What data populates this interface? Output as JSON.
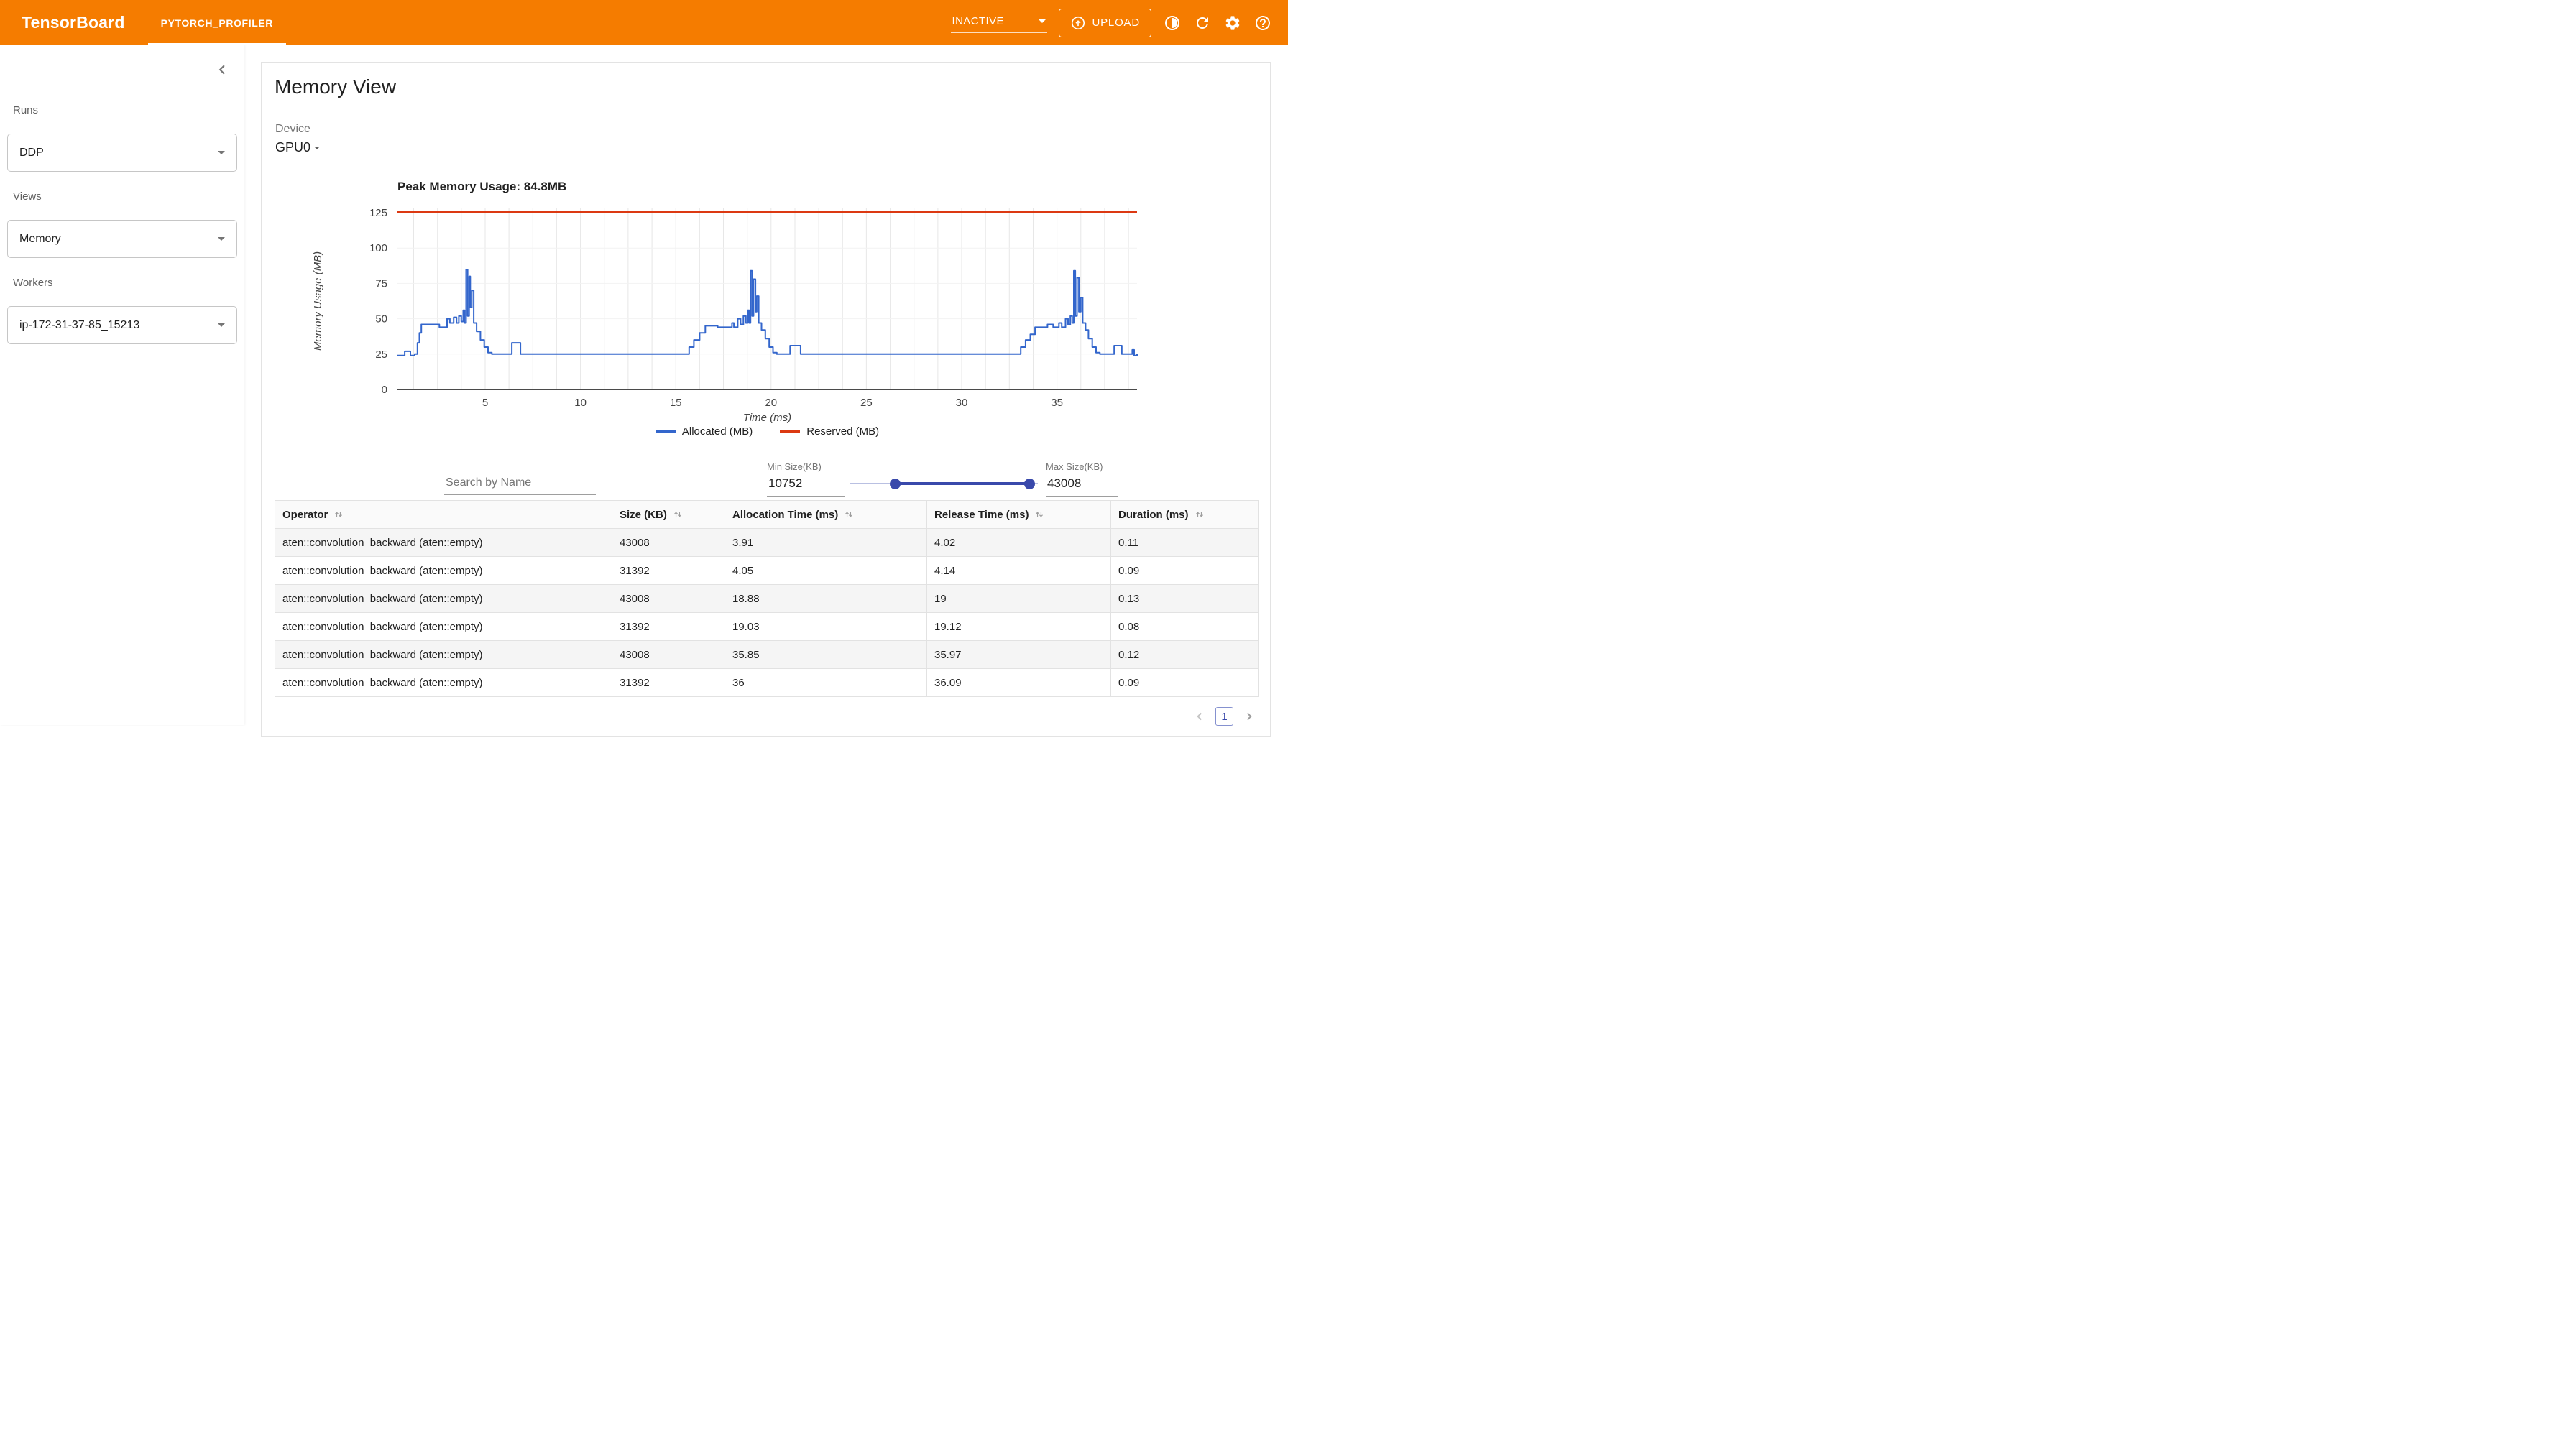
{
  "topbar": {
    "brand": "TensorBoard",
    "tab": "PYTORCH_PROFILER",
    "status_select": "INACTIVE",
    "upload_label": "UPLOAD",
    "color": "#f57c00"
  },
  "icons": {
    "topbar": [
      "contrast-icon",
      "refresh-icon",
      "gear-icon",
      "help-icon"
    ],
    "upload": "upload-circle-arrow-icon",
    "sidebar_collapse": "chevron-left-icon",
    "selects": "chevron-down-icon",
    "table_sort": "sort-arrows-icon",
    "pagination": [
      "chevron-left-icon",
      "chevron-right-icon"
    ]
  },
  "sidebar": {
    "runs_label": "Runs",
    "runs_value": "DDP",
    "views_label": "Views",
    "views_value": "Memory",
    "workers_label": "Workers",
    "workers_value": "ip-172-31-37-85_15213"
  },
  "main": {
    "title": "Memory View",
    "device_label": "Device",
    "device_value": "GPU0"
  },
  "chart_data": {
    "type": "line",
    "title": "Peak Memory Usage: 84.8MB",
    "xlabel": "Time (ms)",
    "ylabel": "Memory Usage (MB)",
    "xlim": [
      0.4,
      39.2
    ],
    "ylim": [
      0,
      125
    ],
    "xticks": [
      5,
      10,
      15,
      20,
      25,
      30,
      35
    ],
    "yticks": [
      0,
      25,
      50,
      75,
      100,
      125
    ],
    "grid": true,
    "legend_position": "bottom",
    "peak_memory_mb": 84.8,
    "series": [
      {
        "name": "Allocated (MB)",
        "color": "#3366cc",
        "style": "step",
        "points": [
          [
            0.4,
            24
          ],
          [
            0.7,
            24
          ],
          [
            0.78,
            27
          ],
          [
            1.02,
            27
          ],
          [
            1.08,
            24
          ],
          [
            1.3,
            25
          ],
          [
            1.45,
            33
          ],
          [
            1.55,
            40
          ],
          [
            1.65,
            46
          ],
          [
            2.5,
            46
          ],
          [
            2.6,
            44
          ],
          [
            2.9,
            44
          ],
          [
            3.0,
            50
          ],
          [
            3.15,
            47
          ],
          [
            3.35,
            51
          ],
          [
            3.5,
            47
          ],
          [
            3.62,
            52
          ],
          [
            3.75,
            48
          ],
          [
            3.85,
            56
          ],
          [
            3.92,
            47
          ],
          [
            4.0,
            84.8
          ],
          [
            4.08,
            52
          ],
          [
            4.16,
            80
          ],
          [
            4.22,
            58
          ],
          [
            4.3,
            70
          ],
          [
            4.4,
            47
          ],
          [
            4.55,
            41
          ],
          [
            4.75,
            35
          ],
          [
            4.95,
            30
          ],
          [
            5.15,
            26
          ],
          [
            5.35,
            25
          ],
          [
            6.3,
            25
          ],
          [
            6.4,
            33
          ],
          [
            6.75,
            33
          ],
          [
            6.85,
            25
          ],
          [
            15.5,
            25
          ],
          [
            15.7,
            30
          ],
          [
            15.95,
            35
          ],
          [
            16.25,
            40
          ],
          [
            16.55,
            45
          ],
          [
            16.95,
            45
          ],
          [
            17.2,
            44
          ],
          [
            17.8,
            44
          ],
          [
            17.95,
            47
          ],
          [
            18.05,
            44
          ],
          [
            18.25,
            50
          ],
          [
            18.4,
            46
          ],
          [
            18.55,
            52
          ],
          [
            18.68,
            47
          ],
          [
            18.78,
            56
          ],
          [
            18.85,
            47
          ],
          [
            18.92,
            84
          ],
          [
            19.0,
            52
          ],
          [
            19.08,
            78
          ],
          [
            19.18,
            55
          ],
          [
            19.25,
            66
          ],
          [
            19.35,
            47
          ],
          [
            19.5,
            42
          ],
          [
            19.7,
            36
          ],
          [
            19.9,
            30
          ],
          [
            20.1,
            26
          ],
          [
            20.3,
            25
          ],
          [
            20.9,
            25
          ],
          [
            21.0,
            31
          ],
          [
            21.45,
            31
          ],
          [
            21.55,
            25
          ],
          [
            32.9,
            25
          ],
          [
            33.1,
            30
          ],
          [
            33.35,
            35
          ],
          [
            33.6,
            39
          ],
          [
            33.85,
            44
          ],
          [
            34.2,
            44
          ],
          [
            34.5,
            46
          ],
          [
            34.8,
            44
          ],
          [
            35.1,
            47
          ],
          [
            35.25,
            44
          ],
          [
            35.45,
            50
          ],
          [
            35.58,
            46
          ],
          [
            35.7,
            52
          ],
          [
            35.8,
            47
          ],
          [
            35.88,
            84
          ],
          [
            35.96,
            52
          ],
          [
            36.05,
            79
          ],
          [
            36.15,
            55
          ],
          [
            36.25,
            65
          ],
          [
            36.35,
            47
          ],
          [
            36.5,
            42
          ],
          [
            36.65,
            36
          ],
          [
            36.85,
            30
          ],
          [
            37.05,
            26
          ],
          [
            37.25,
            25
          ],
          [
            37.9,
            25
          ],
          [
            38.0,
            31
          ],
          [
            38.3,
            31
          ],
          [
            38.4,
            25
          ],
          [
            38.9,
            25
          ],
          [
            38.95,
            28
          ],
          [
            39.05,
            24
          ],
          [
            39.2,
            25
          ]
        ]
      },
      {
        "name": "Reserved (MB)",
        "color": "#dc3912",
        "style": "line",
        "points": [
          [
            0.4,
            125.5
          ],
          [
            39.2,
            125.5
          ]
        ]
      }
    ]
  },
  "filters": {
    "search_placeholder": "Search by Name",
    "min_label": "Min Size(KB)",
    "min_value": "10752",
    "max_label": "Max Size(KB)",
    "max_value": "43008",
    "slider": {
      "min_pos": 0.244,
      "max_pos": 0.958,
      "color": "#3949ab"
    }
  },
  "table": {
    "columns": [
      "Operator",
      "Size (KB)",
      "Allocation Time (ms)",
      "Release Time (ms)",
      "Duration (ms)"
    ],
    "rows": [
      [
        "aten::convolution_backward (aten::empty)",
        "43008",
        "3.91",
        "4.02",
        "0.11"
      ],
      [
        "aten::convolution_backward (aten::empty)",
        "31392",
        "4.05",
        "4.14",
        "0.09"
      ],
      [
        "aten::convolution_backward (aten::empty)",
        "43008",
        "18.88",
        "19",
        "0.13"
      ],
      [
        "aten::convolution_backward (aten::empty)",
        "31392",
        "19.03",
        "19.12",
        "0.08"
      ],
      [
        "aten::convolution_backward (aten::empty)",
        "43008",
        "35.85",
        "35.97",
        "0.12"
      ],
      [
        "aten::convolution_backward (aten::empty)",
        "31392",
        "36",
        "36.09",
        "0.09"
      ]
    ]
  },
  "pagination": {
    "page": "1"
  }
}
